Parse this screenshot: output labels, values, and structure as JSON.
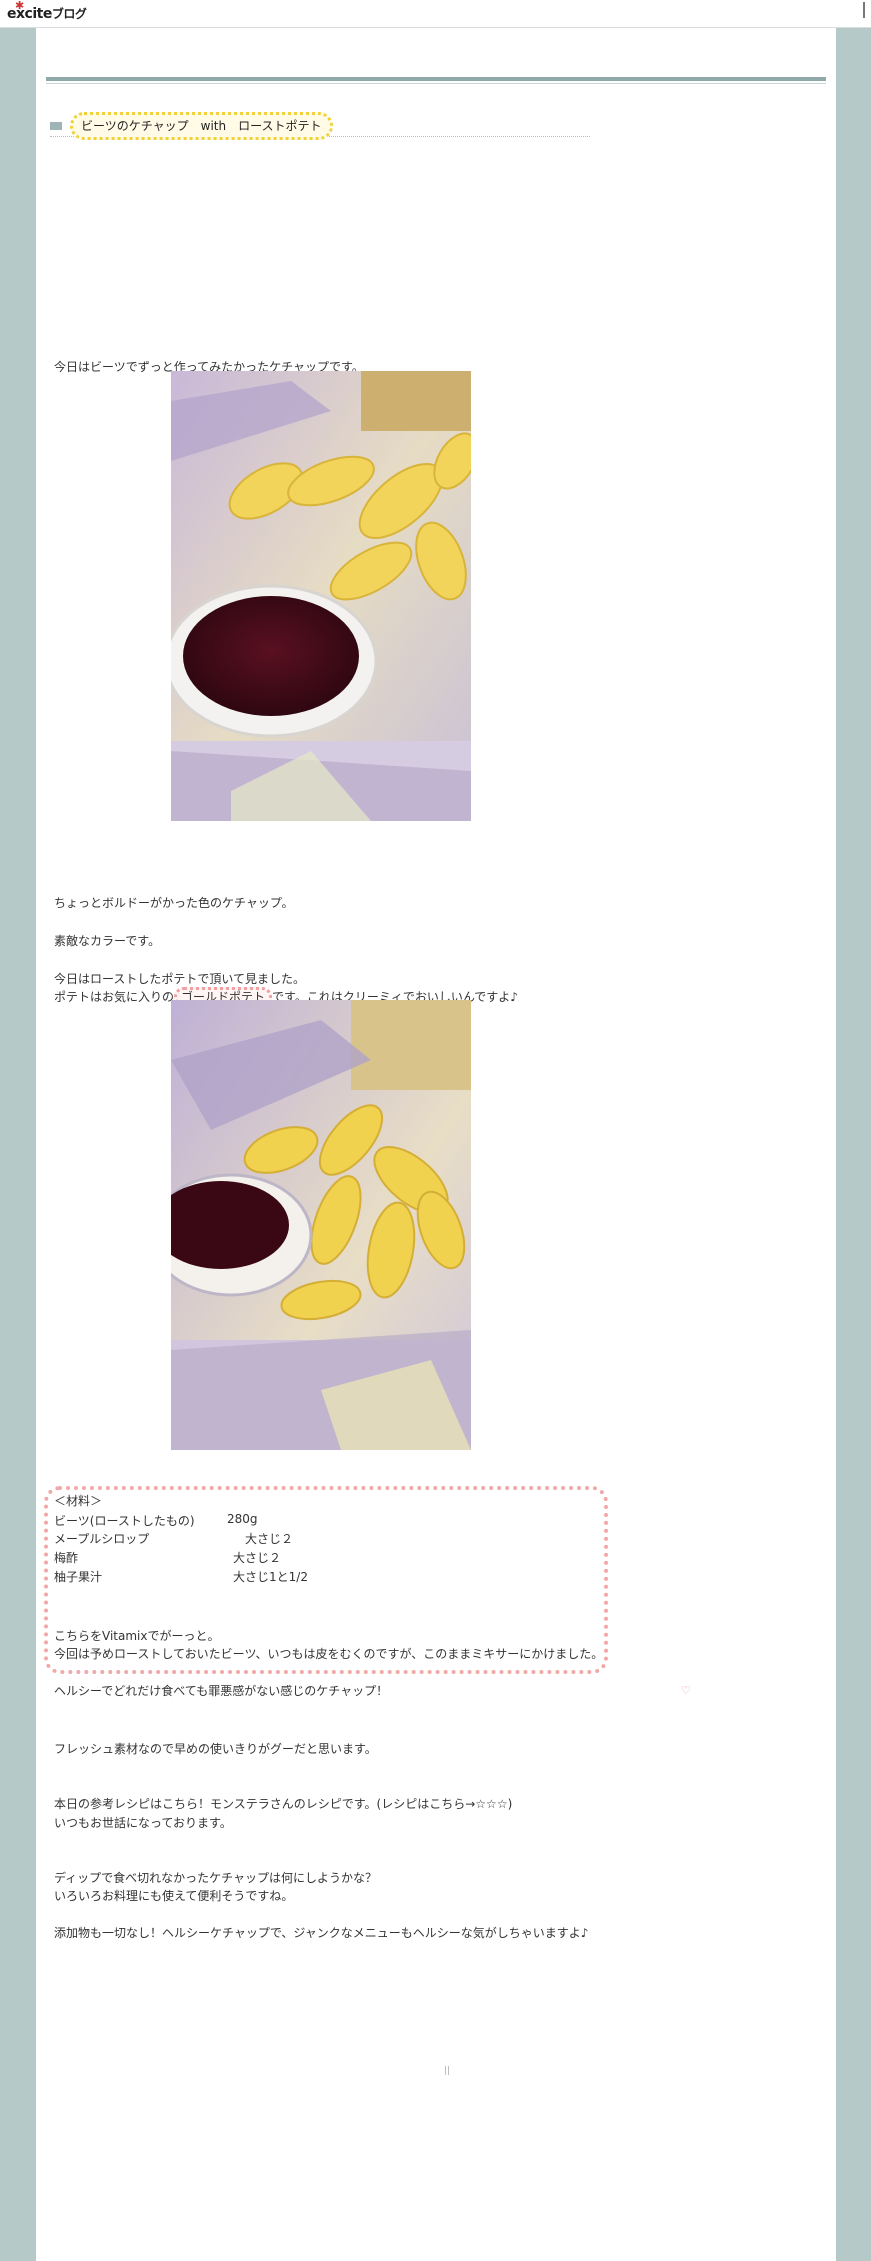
{
  "header": {
    "logo_text": "excite",
    "logo_sub": "ブログ"
  },
  "post": {
    "title": "ビーツのケチャップ　with　ローストポテト",
    "intro": "今日はビーツでずっと作ってみたかったケチャップです。",
    "p1": "ちょっとボルドーがかった色のケチャップ。",
    "p2": "素敵なカラーです。",
    "p3a": "今日はローストしたポテトで頂いて見ました。",
    "p3b_pre": "ポテトはお気に入りの",
    "p3b_highlight": "ゴールドポテト",
    "p3b_post": "です。これはクリーミィでおいしいんですよ♪",
    "recipe": {
      "header": "＜材料＞",
      "rows": [
        {
          "name": "ビーツ(ローストしたもの)",
          "qty": "280g"
        },
        {
          "name": "メープルシロップ",
          "qty": "大さじ２"
        },
        {
          "name": "梅酢",
          "qty": "大さじ２"
        },
        {
          "name": "柚子果汁",
          "qty": "大さじ1と1/2"
        }
      ],
      "note1": "こちらをVitamixでがーっと。",
      "note2": "今回は予めローストしておいたビーツ、いつもは皮をむくのですが、このままミキサーにかけました。"
    },
    "after1": "ヘルシーでどれだけ食べても罪悪感がない感じのケチャップ！",
    "after2": "フレッシュ素材なので早めの使いきりがグーだと思います。",
    "after3": "本日の参考レシピはこちら！モンステラさんのレシピです。(レシピはこちら→☆☆☆)",
    "after4": "いつもお世話になっております。",
    "after5": "ディップで食べ切れなかったケチャップは何にしようかな？",
    "after6": "いろいろお料理にも使えて便利そうですね。",
    "after7": "添加物も一切なし！ヘルシーケチャップで、ジャンクなメニューもヘルシーな気がしちゃいますよ♪"
  }
}
